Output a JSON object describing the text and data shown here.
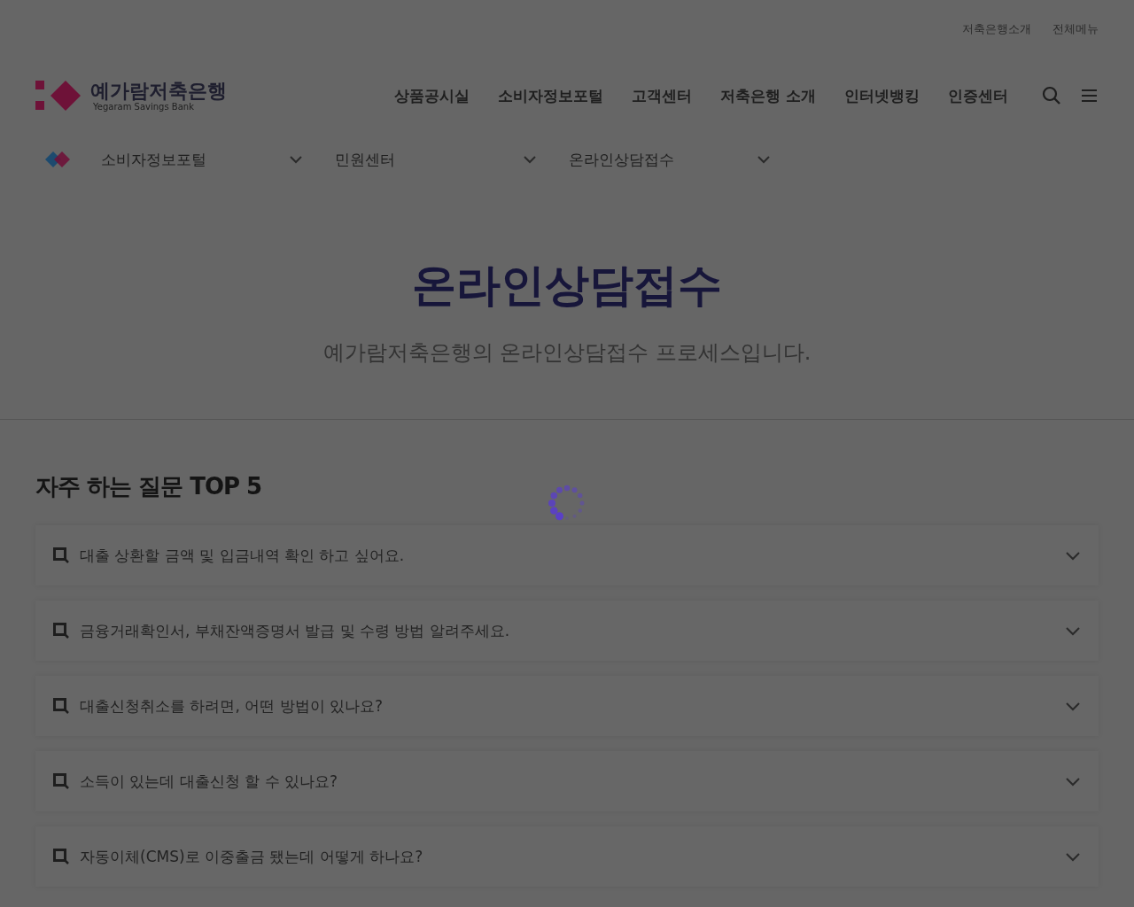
{
  "top_links": [
    "저축은행소개",
    "전체메뉴"
  ],
  "logo": {
    "name": "예가람저축은행",
    "subtitle": "Yegaram Savings Bank"
  },
  "nav": [
    "상품공시실",
    "소비자정보포털",
    "고객센터",
    "저축은행 소개",
    "인터넷뱅킹",
    "인증센터"
  ],
  "breadcrumb": [
    {
      "label": "소비자정보포털",
      "expanded": false
    },
    {
      "label": "민원센터",
      "expanded": false
    },
    {
      "label": "온라인상담접수",
      "expanded": false
    }
  ],
  "hero": {
    "title": "온라인상담접수",
    "subtitle": "예가람저축은행의 온라인상담접수 프로세스입니다."
  },
  "faq": {
    "title": "자주 하는 질문 TOP 5",
    "items": [
      {
        "question": "대출 상환할 금액 및 입금내역 확인 하고 싶어요.",
        "expanded": false
      },
      {
        "question": "금융거래확인서, 부채잔액증명서 발급 및 수령 방법 알려주세요.",
        "expanded": false
      },
      {
        "question": "대출신청취소를 하려면, 어떤 방법이 있나요?",
        "expanded": false
      },
      {
        "question": "소득이 있는데 대출신청 할 수 있나요?",
        "expanded": false
      },
      {
        "question": "자동이체(CMS)로 이중출금 됐는데 어떻게 하나요?",
        "expanded": false
      }
    ]
  }
}
